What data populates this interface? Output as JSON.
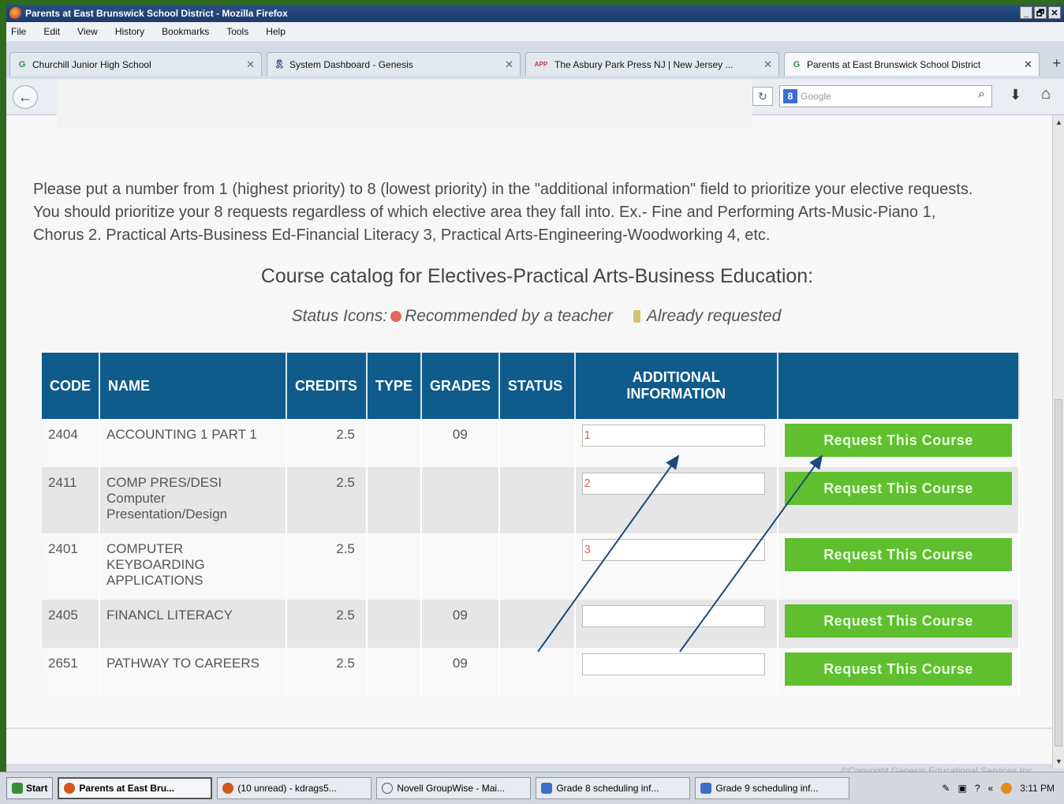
{
  "window": {
    "title": "Parents at East Brunswick School District - Mozilla Firefox",
    "controls": [
      "_",
      "🗗",
      "✕"
    ]
  },
  "menu": [
    "File",
    "Edit",
    "View",
    "History",
    "Bookmarks",
    "Tools",
    "Help"
  ],
  "tabs": [
    {
      "label": "Churchill Junior High School",
      "icon": "google-icon"
    },
    {
      "label": "System Dashboard - Genesis",
      "icon": "ribbon-icon"
    },
    {
      "label": "The Asbury Park Press NJ | New Jersey ...",
      "icon": "app-icon",
      "favicon_text": "APP"
    },
    {
      "label": "Parents at East Brunswick School District",
      "icon": "google-icon",
      "active": true
    }
  ],
  "navbar": {
    "search_placeholder": "Google"
  },
  "page": {
    "instructions": "Please put a number from 1 (highest priority) to 8 (lowest priority) in the \"additional information\" field to prioritize your elective requests. You should prioritize your 8 requests regardless of which elective area they fall into. Ex.- Fine and Performing Arts-Music-Piano 1, Chorus 2. Practical Arts-Business Ed-Financial Literacy 3, Practical Arts-Engineering-Woodworking 4, etc.",
    "catalog_title": "Course catalog for Electives-Practical Arts-Business Education:",
    "status_label": "Status Icons:",
    "status_recommended": "Recommended by a teacher",
    "status_requested": "Already requested",
    "table_headers": [
      "CODE",
      "NAME",
      "CREDITS",
      "TYPE",
      "GRADES",
      "STATUS",
      "ADDITIONAL INFORMATION",
      ""
    ],
    "courses": [
      {
        "code": "2404",
        "name": "ACCOUNTING 1 PART 1",
        "credits": "2.5",
        "type": "",
        "grades": "09",
        "status": "",
        "info": "1",
        "button": "Request This Course"
      },
      {
        "code": "2411",
        "name": "COMP PRES/DESI Computer Presentation/Design",
        "credits": "2.5",
        "type": "",
        "grades": "",
        "status": "",
        "info": "2",
        "button": "Request This Course"
      },
      {
        "code": "2401",
        "name": "COMPUTER KEYBOARDING APPLICATIONS",
        "credits": "2.5",
        "type": "",
        "grades": "",
        "status": "",
        "info": "3",
        "button": "Request This Course"
      },
      {
        "code": "2405",
        "name": "FINANCL LITERACY",
        "credits": "2.5",
        "type": "",
        "grades": "09",
        "status": "",
        "info": "",
        "button": "Request This Course"
      },
      {
        "code": "2651",
        "name": "PATHWAY TO CAREERS",
        "credits": "2.5",
        "type": "",
        "grades": "09",
        "status": "",
        "info": "",
        "button": "Request This Course"
      }
    ],
    "copyright": "©Copyright Genesis Educational Services,Inc."
  },
  "taskbar": {
    "start": "Start",
    "items": [
      {
        "label": "Parents at East Bru...",
        "active": true
      },
      {
        "label": "(10 unread) - kdrags5..."
      },
      {
        "label": "Novell GroupWise - Mai..."
      },
      {
        "label": "Grade 8 scheduling inf..."
      },
      {
        "label": "Grade 9 scheduling inf..."
      }
    ],
    "clock": "3:11 PM"
  },
  "colors": {
    "header_blue": "#0f5b8c",
    "button_green": "#5fbf2e",
    "frame_green": "#2f6b1f",
    "annotation_arrow": "#1d4a7a"
  }
}
